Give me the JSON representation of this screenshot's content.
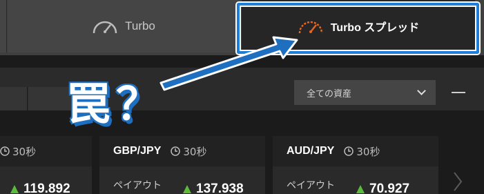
{
  "tabs": [
    {
      "label": "Turbo"
    },
    {
      "label": "Turbo スプレッド"
    }
  ],
  "callout": {
    "text": "罠？"
  },
  "filter": {
    "asset_select": "全ての資産"
  },
  "cards": [
    {
      "pair": "",
      "duration": "30秒",
      "price": "119.892"
    },
    {
      "pair": "GBP/JPY",
      "duration": "30秒",
      "payout_label": "ペイアウト",
      "price": "137.938"
    },
    {
      "pair": "AUD/JPY",
      "duration": "30秒",
      "payout_label": "ペイアウト",
      "price": "70.927"
    }
  ],
  "colors": {
    "highlight": "#1f7fd6",
    "accent_orange": "#e8641f",
    "up_green": "#5dbb3a"
  },
  "icons": [
    "speedometer-icon",
    "speedometer-icon-orange",
    "chevron-down-icon",
    "minimize-icon",
    "clock-icon",
    "up-arrow-icon",
    "chevron-right-icon"
  ]
}
